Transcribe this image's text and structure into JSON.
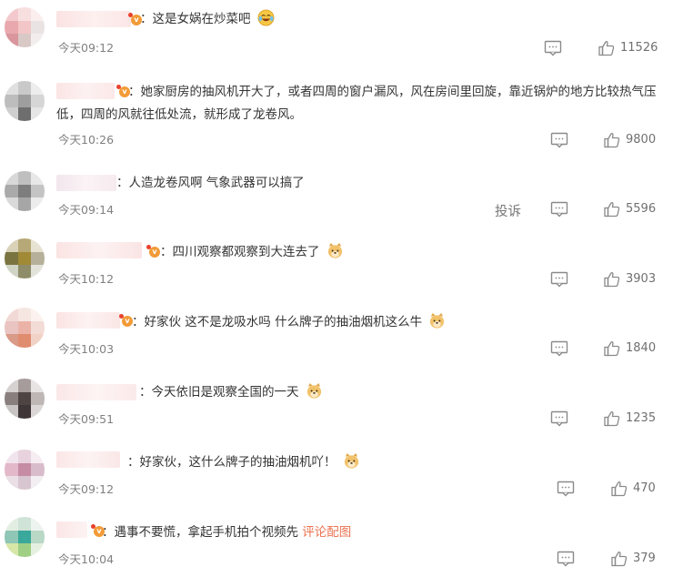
{
  "comments": [
    {
      "text": "：这是女娲在炒菜吧",
      "time": "今天09:12",
      "likes": "11526",
      "emoji": "laugh-cry"
    },
    {
      "text": "：她家厨房的抽风机开大了，或者四周的窗户漏风，风在房间里回旋，靠近锅炉的地方比较热气压低，四周的风就往低处流，就形成了龙卷风。",
      "time": "今天10:26",
      "likes": "9800"
    },
    {
      "text": "：人造龙卷风啊 气象武器可以搞了",
      "time": "今天09:14",
      "likes": "5596",
      "report": "投诉"
    },
    {
      "text": "：四川观察都观察到大连去了",
      "time": "今天10:12",
      "likes": "3903",
      "emoji": "doge"
    },
    {
      "text": "：好家伙 这不是龙吸水吗 什么牌子的抽油烟机这么牛",
      "time": "今天10:03",
      "likes": "1840",
      "emoji": "doge"
    },
    {
      "text": "：今天依旧是观察全国的一天",
      "time": "今天09:51",
      "likes": "1235",
      "emoji": "doge"
    },
    {
      "text": "：好家伙，这什么牌子的抽油烟机吖！",
      "time": "今天09:12",
      "likes": "470",
      "emoji": "doge"
    },
    {
      "text": "：遇事不要慌，拿起手机拍个视频先",
      "link": "评论配图",
      "time": "今天10:04",
      "likes": "379"
    }
  ],
  "colors": {
    "text": "#333333",
    "time": "#808080",
    "link": "#eb7350",
    "icon": "#8a8a8a",
    "vip": "#f29b38"
  },
  "icons": {
    "reply": "comment-icon",
    "like": "thumbs-up-icon",
    "vip": "vip-badge-icon"
  }
}
